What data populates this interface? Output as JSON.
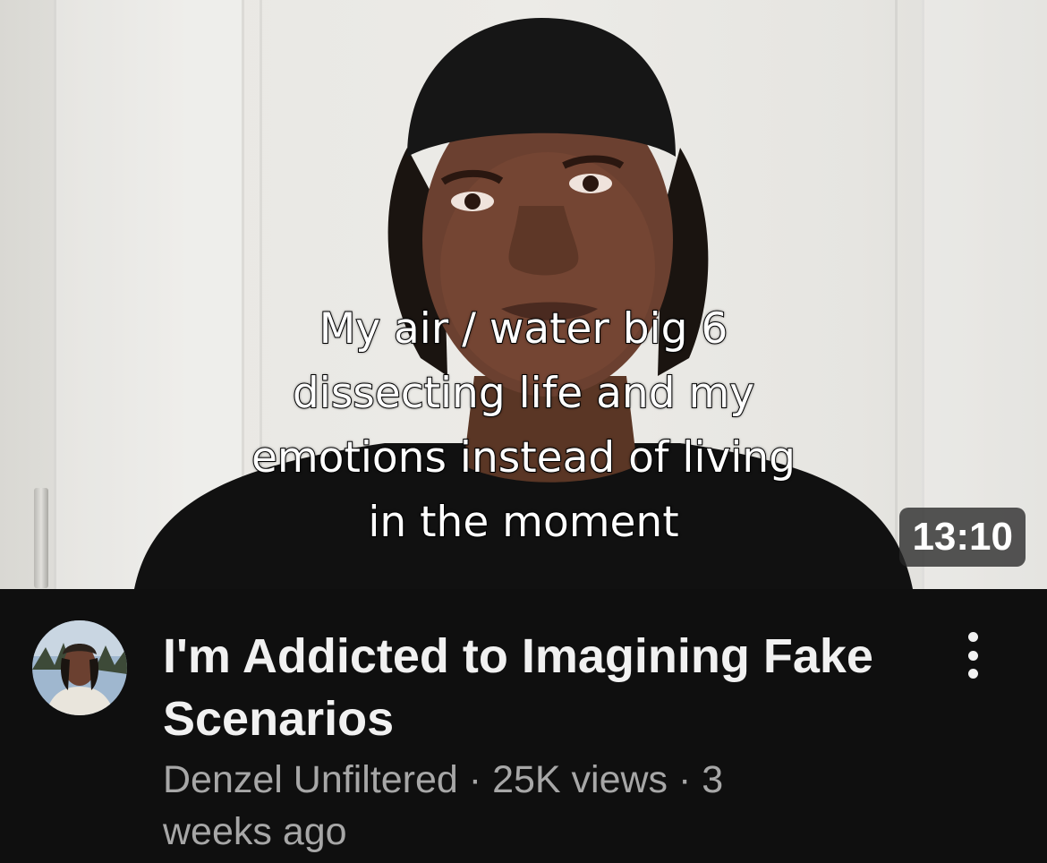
{
  "video": {
    "caption_lines": [
      "My air / water big 6",
      "dissecting life and my",
      "emotions instead of living",
      "in the moment"
    ],
    "duration": "13:10",
    "title": "I'm Addicted to Imagining Fake Scenarios",
    "channel": "Denzel Unfiltered",
    "separator": "·",
    "views": "25K views",
    "age": "3 weeks ago"
  },
  "icons": {
    "menu": "more-vert-icon",
    "avatar": "channel-avatar"
  },
  "colors": {
    "background": "#0f0f0f",
    "title": "#f1f1f1",
    "secondary_text": "#a7a7a7",
    "duration_badge": "#282828"
  }
}
